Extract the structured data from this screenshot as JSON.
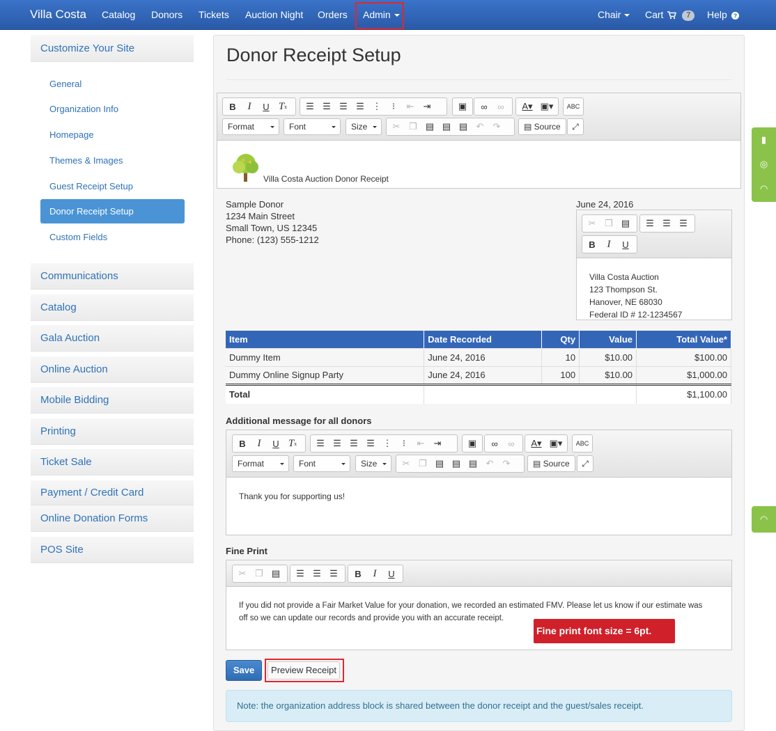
{
  "navbar": {
    "brand": "Villa Costa",
    "items": [
      "Catalog",
      "Donors",
      "Tickets",
      "Auction Night",
      "Orders",
      "Admin"
    ],
    "chair": "Chair",
    "cart": "Cart",
    "cart_count": "7",
    "help": "Help"
  },
  "sidebar": {
    "section_title": "Customize Your Site",
    "sub_items": [
      "General",
      "Organization Info",
      "Homepage",
      "Themes & Images",
      "Guest Receipt Setup",
      "Donor Receipt Setup",
      "Custom Fields"
    ],
    "active": "Donor Receipt Setup",
    "sections": [
      "Communications",
      "Catalog",
      "Gala Auction",
      "Online Auction",
      "Mobile Bidding",
      "Printing",
      "Ticket Sale",
      "Payment / Credit Card",
      "Online Donation Forms",
      "POS Site"
    ]
  },
  "main": {
    "title": "Donor Receipt Setup",
    "header_editor": {
      "format": "Format",
      "font": "Font",
      "size": "Size",
      "source": "Source",
      "receipt_title": "Villa Costa Auction Donor Receipt"
    },
    "donor": {
      "name": "Sample Donor",
      "street": "1234 Main Street",
      "city": "Small Town, US 12345",
      "phone": "Phone: (123) 555-1212"
    },
    "date": "June 24, 2016",
    "org_address": {
      "name": "Villa Costa Auction",
      "street": "123 Thompson St.",
      "city": "Hanover, NE 68030",
      "federal_id": "Federal ID # 12-1234567"
    },
    "table": {
      "headers": [
        "Item",
        "Date Recorded",
        "Qty",
        "Value",
        "Total Value*"
      ],
      "rows": [
        [
          "Dummy Item",
          "June 24, 2016",
          "10",
          "$10.00",
          "$100.00"
        ],
        [
          "Dummy Online Signup Party",
          "June 24, 2016",
          "100",
          "$10.00",
          "$1,000.00"
        ]
      ],
      "total_label": "Total",
      "total_value": "$1,100.00"
    },
    "additional": {
      "label": "Additional message for all donors",
      "format": "Format",
      "font": "Font",
      "size": "Size",
      "source": "Source",
      "text": "Thank you for supporting us!"
    },
    "fine_print": {
      "label": "Fine Print",
      "line1": "If you did not provide a Fair Market Value for your donation, we recorded an estimated FMV. Please let us know if our estimate was",
      "line2": "off so we can update our records and provide you with an accurate receipt.",
      "callout": "Fine print font size = 6pt."
    },
    "save": "Save",
    "preview": "Preview Receipt",
    "note": "Note: the organization address block is shared between the donor receipt and the guest/sales receipt."
  },
  "colors": {
    "navbar": "#2f62b3",
    "link": "#2f72b8",
    "active_item": "#4a94d6",
    "table_header": "#3466b8",
    "highlight": "#e3262d",
    "side_tabs": "#8bc34a",
    "note_bg": "#d9edf7"
  },
  "icons": [
    "cart-icon",
    "help-icon",
    "tree-logo-icon",
    "book-icon",
    "lifebuoy-icon",
    "rss-icon"
  ]
}
